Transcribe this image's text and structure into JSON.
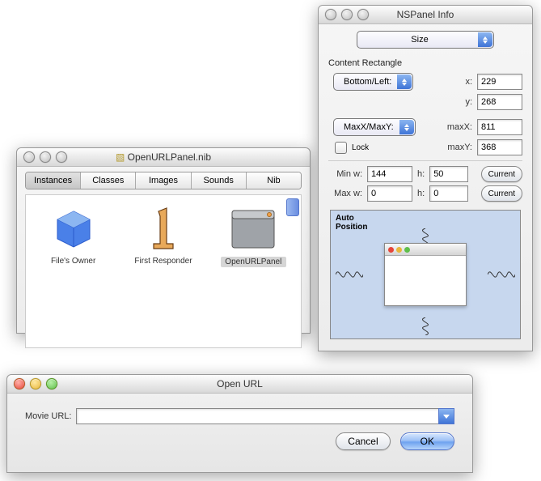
{
  "nib_window": {
    "title": "OpenURLPanel.nib",
    "tabs": [
      "Instances",
      "Classes",
      "Images",
      "Sounds",
      "Nib"
    ],
    "active_tab": 0,
    "items": [
      {
        "label": "File's Owner"
      },
      {
        "label": "First Responder"
      },
      {
        "label": "OpenURLPanel"
      }
    ]
  },
  "inspector": {
    "title": "NSPanel Info",
    "mode_label": "Size",
    "section_label": "Content Rectangle",
    "origin_popup": "Bottom/Left:",
    "extent_popup": "MaxX/MaxY:",
    "x_label": "x:",
    "x_value": "229",
    "y_label": "y:",
    "y_value": "268",
    "maxx_label": "maxX:",
    "maxx_value": "811",
    "maxy_label": "maxY:",
    "maxy_value": "368",
    "lock_label": "Lock",
    "minw_label": "Min w:",
    "minw_value": "144",
    "minh_label": "h:",
    "minh_value": "50",
    "maxw_label": "Max w:",
    "maxw_value": "0",
    "maxh_label": "h:",
    "maxh_value": "0",
    "current_label": "Current",
    "autopos_label": "Auto\nPosition"
  },
  "openurl": {
    "title": "Open URL",
    "field_label": "Movie URL:",
    "field_value": "",
    "cancel": "Cancel",
    "ok": "OK"
  }
}
